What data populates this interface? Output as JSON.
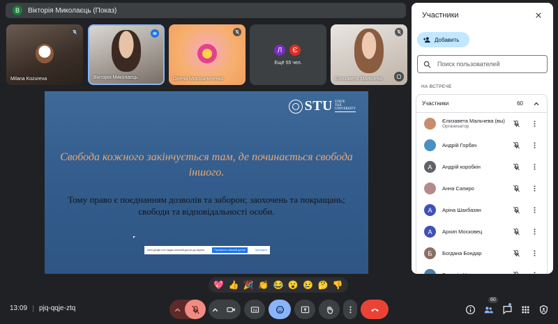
{
  "meeting": {
    "presenter_badge": "В",
    "title": "Вікторія Миколаєць (Показ)",
    "time": "13:09",
    "code": "pjq-qqje-ztq"
  },
  "tiles": [
    {
      "name": "Milana Kozureva"
    },
    {
      "name": "Вікторія Миколаєць"
    },
    {
      "name": "Олена Мирошниченко"
    },
    {
      "avatar1": "Л",
      "avatar2": "Є",
      "more": "Ещё 55 чел."
    },
    {
      "name": "Єлизавета Мальчева"
    }
  ],
  "slide": {
    "logo": "STU",
    "logo_small1": "STATE",
    "logo_small2": "TAX",
    "logo_small3": "UNIVERSITY",
    "quote": "Свобода кожного закінчується там, де починається свобода іншого.",
    "body": "Тому право є поєднанням дозволів та заборон; заохочень та покращань; свободи та відповідальності особи.",
    "share_msg": "meet.google.com надає спільний доступ до екрана.",
    "share_btn": "Припинити спільний доступ",
    "share_hide": "Приховати"
  },
  "reactions": [
    "💖",
    "👍",
    "🎉",
    "👏",
    "😂",
    "😮",
    "😢",
    "🤔",
    "👎"
  ],
  "toolbar": {
    "people_count": "60"
  },
  "panel": {
    "title": "Участники",
    "add_label": "Добавить",
    "search_placeholder": "Поиск пользователей",
    "section": "НА ВСТРЕЧЕ",
    "list_title": "Участники",
    "count": "60",
    "participants": [
      {
        "name": "Єлизавета Мальчева (вы)",
        "sub": "Организатор",
        "initial": "",
        "color": "#c98d6e"
      },
      {
        "name": "Андрій Горбач",
        "sub": "",
        "initial": "",
        "color": "#4a90c2"
      },
      {
        "name": "Андрій коробкін",
        "sub": "",
        "initial": "А",
        "color": "#5f6368"
      },
      {
        "name": "Анна Сапиро",
        "sub": "",
        "initial": "",
        "color": "#b58a8a"
      },
      {
        "name": "Аріна Шахбазян",
        "sub": "",
        "initial": "А",
        "color": "#3f51b5"
      },
      {
        "name": "Архип Московец",
        "sub": "",
        "initial": "А",
        "color": "#3f51b5"
      },
      {
        "name": "Богдана Бондар",
        "sub": "",
        "initial": "Б",
        "color": "#8d6e63"
      },
      {
        "name": "Валерія Н",
        "sub": "",
        "initial": "",
        "color": "#4a7fb0"
      }
    ]
  }
}
